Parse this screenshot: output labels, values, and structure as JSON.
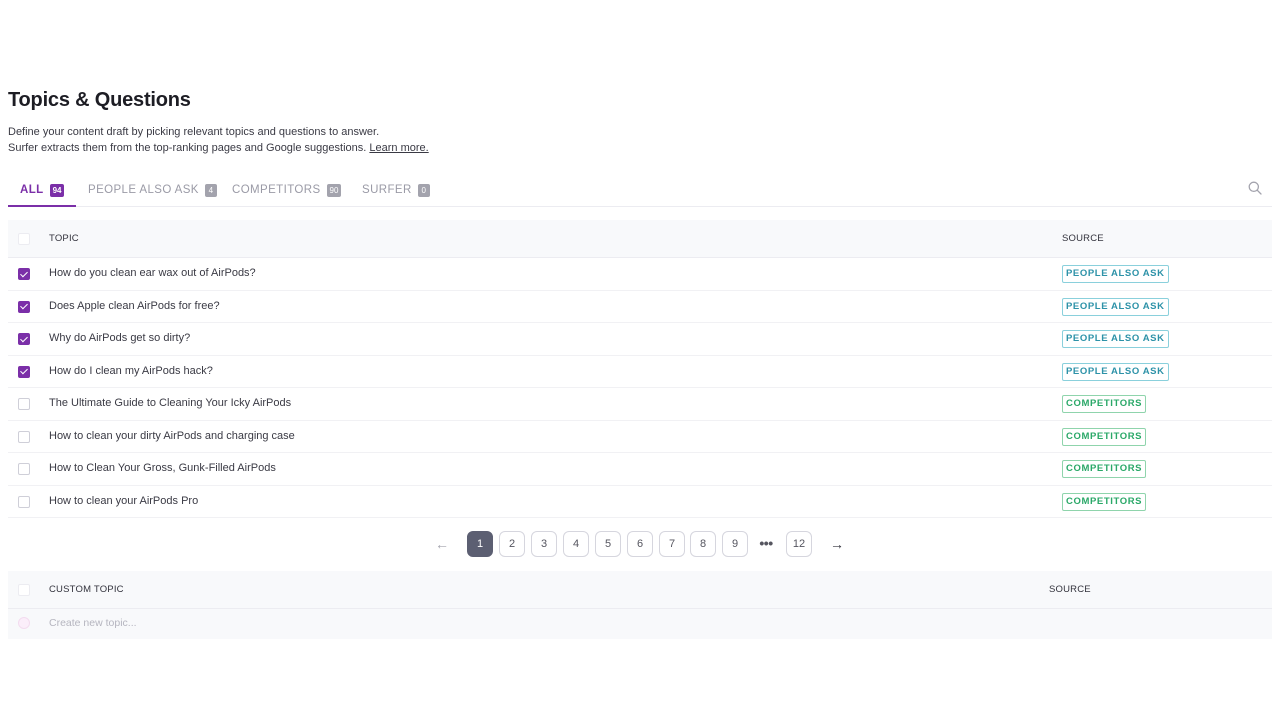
{
  "header": {
    "title": "Topics & Questions",
    "desc_line1": "Define your content draft by picking relevant topics and questions to answer.",
    "desc_line2": "Surfer extracts them from the top-ranking pages and Google suggestions.",
    "learn_more": "Learn more."
  },
  "tabs": [
    {
      "label": "ALL",
      "count": "94",
      "active": true
    },
    {
      "label": "PEOPLE ALSO ASK",
      "count": "4",
      "active": false
    },
    {
      "label": "COMPETITORS",
      "count": "90",
      "active": false
    },
    {
      "label": "SURFER",
      "count": "0",
      "active": false
    }
  ],
  "icons": {
    "search": "search-icon"
  },
  "table": {
    "col_topic": "TOPIC",
    "col_source": "SOURCE",
    "rows": [
      {
        "topic": "How do you clean ear wax out of AirPods?",
        "source": "PEOPLE ALSO ASK",
        "checked": true
      },
      {
        "topic": "Does Apple clean AirPods for free?",
        "source": "PEOPLE ALSO ASK",
        "checked": true
      },
      {
        "topic": "Why do AirPods get so dirty?",
        "source": "PEOPLE ALSO ASK",
        "checked": true
      },
      {
        "topic": "How do I clean my AirPods hack?",
        "source": "PEOPLE ALSO ASK",
        "checked": true
      },
      {
        "topic": "The Ultimate Guide to Cleaning Your Icky AirPods",
        "source": "COMPETITORS",
        "checked": false
      },
      {
        "topic": "How to clean your dirty AirPods and charging case",
        "source": "COMPETITORS",
        "checked": false
      },
      {
        "topic": "How to Clean Your Gross, Gunk-Filled AirPods",
        "source": "COMPETITORS",
        "checked": false
      },
      {
        "topic": "How to clean your AirPods Pro",
        "source": "COMPETITORS",
        "checked": false
      }
    ]
  },
  "pagination": {
    "prev": "←",
    "next": "→",
    "pages": [
      "1",
      "2",
      "3",
      "4",
      "5",
      "6",
      "7",
      "8",
      "9"
    ],
    "ellipsis": "•••",
    "last": "12",
    "current": "1"
  },
  "custom": {
    "col_topic": "CUSTOM TOPIC",
    "col_source": "SOURCE",
    "placeholder": "Create new topic..."
  },
  "colors": {
    "accent": "#7b2fa8",
    "people_also_ask": "#2d92a8",
    "competitors": "#2aa868",
    "active_page": "#5c5f72"
  }
}
